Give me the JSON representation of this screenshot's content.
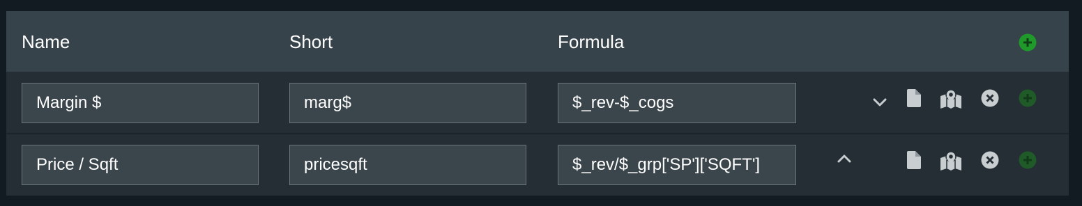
{
  "header": {
    "name_label": "Name",
    "short_label": "Short",
    "formula_label": "Formula"
  },
  "rows": [
    {
      "name": "Margin $",
      "short": "marg$",
      "formula": "$_rev-$_cogs",
      "reorder_icon": "chevron-down-icon",
      "add_state": "disabled"
    },
    {
      "name": "Price / Sqft",
      "short": "pricesqft",
      "formula": "$_rev/$_grp['SP']['SQFT']",
      "reorder_icon": "chevron-up-icon",
      "add_state": "disabled"
    }
  ],
  "icons": {
    "document": "document-icon",
    "map": "map-icon",
    "remove": "close-circle-icon",
    "add": "add-circle-icon"
  },
  "colors": {
    "background": "#131b22",
    "header": "#37434a",
    "row": "#252e35",
    "input": "#3a454c",
    "input_border": "#6a757c",
    "text": "#ffffff",
    "icon": "#c8cdd0",
    "add_active": "#1f9a2a",
    "add_disabled": "#1f5a28"
  }
}
